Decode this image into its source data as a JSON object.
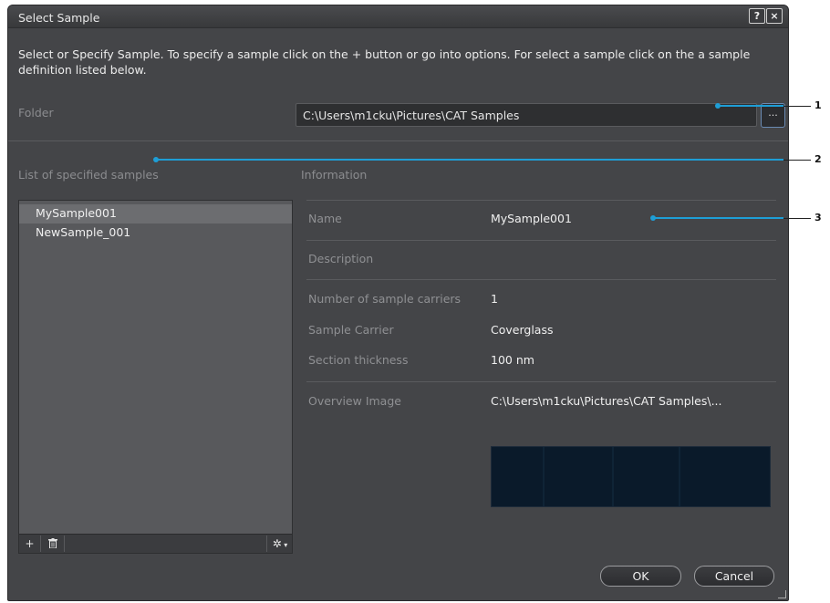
{
  "dialog": {
    "title": "Select Sample",
    "help_glyph": "?",
    "close_glyph": "×",
    "intro_text": "Select or Specify Sample. To specify a sample click on the + button or go into options. For select a sample click on the a sample definition listed below."
  },
  "folder": {
    "label": "Folder",
    "path": "C:\\Users\\m1cku\\Pictures\\CAT Samples",
    "browse_label": "..."
  },
  "samples": {
    "title": "List of specified samples",
    "items": [
      {
        "label": "MySample001",
        "selected": true
      },
      {
        "label": "NewSample_001",
        "selected": false
      }
    ],
    "toolbar": {
      "add_glyph": "+",
      "delete_icon": "trash-icon",
      "settings_icon": "gear-icon"
    }
  },
  "information": {
    "title": "Information",
    "name_label": "Name",
    "name_value": "MySample001",
    "description_label": "Description",
    "description_value": "",
    "carriers_label": "Number of sample carriers",
    "carriers_value": "1",
    "carrier_label": "Sample Carrier",
    "carrier_value": "Coverglass",
    "thickness_label": "Section thickness",
    "thickness_value": "100 nm",
    "overview_label": "Overview Image",
    "overview_value": "C:\\Users\\m1cku\\Pictures\\CAT Samples\\..."
  },
  "buttons": {
    "ok": "OK",
    "cancel": "Cancel"
  },
  "callouts": {
    "one": "1",
    "two": "2",
    "three": "3"
  },
  "colors": {
    "accent": "#1e9ed6",
    "dialog_bg": "#444548",
    "selected_row": "#6c6d70"
  }
}
